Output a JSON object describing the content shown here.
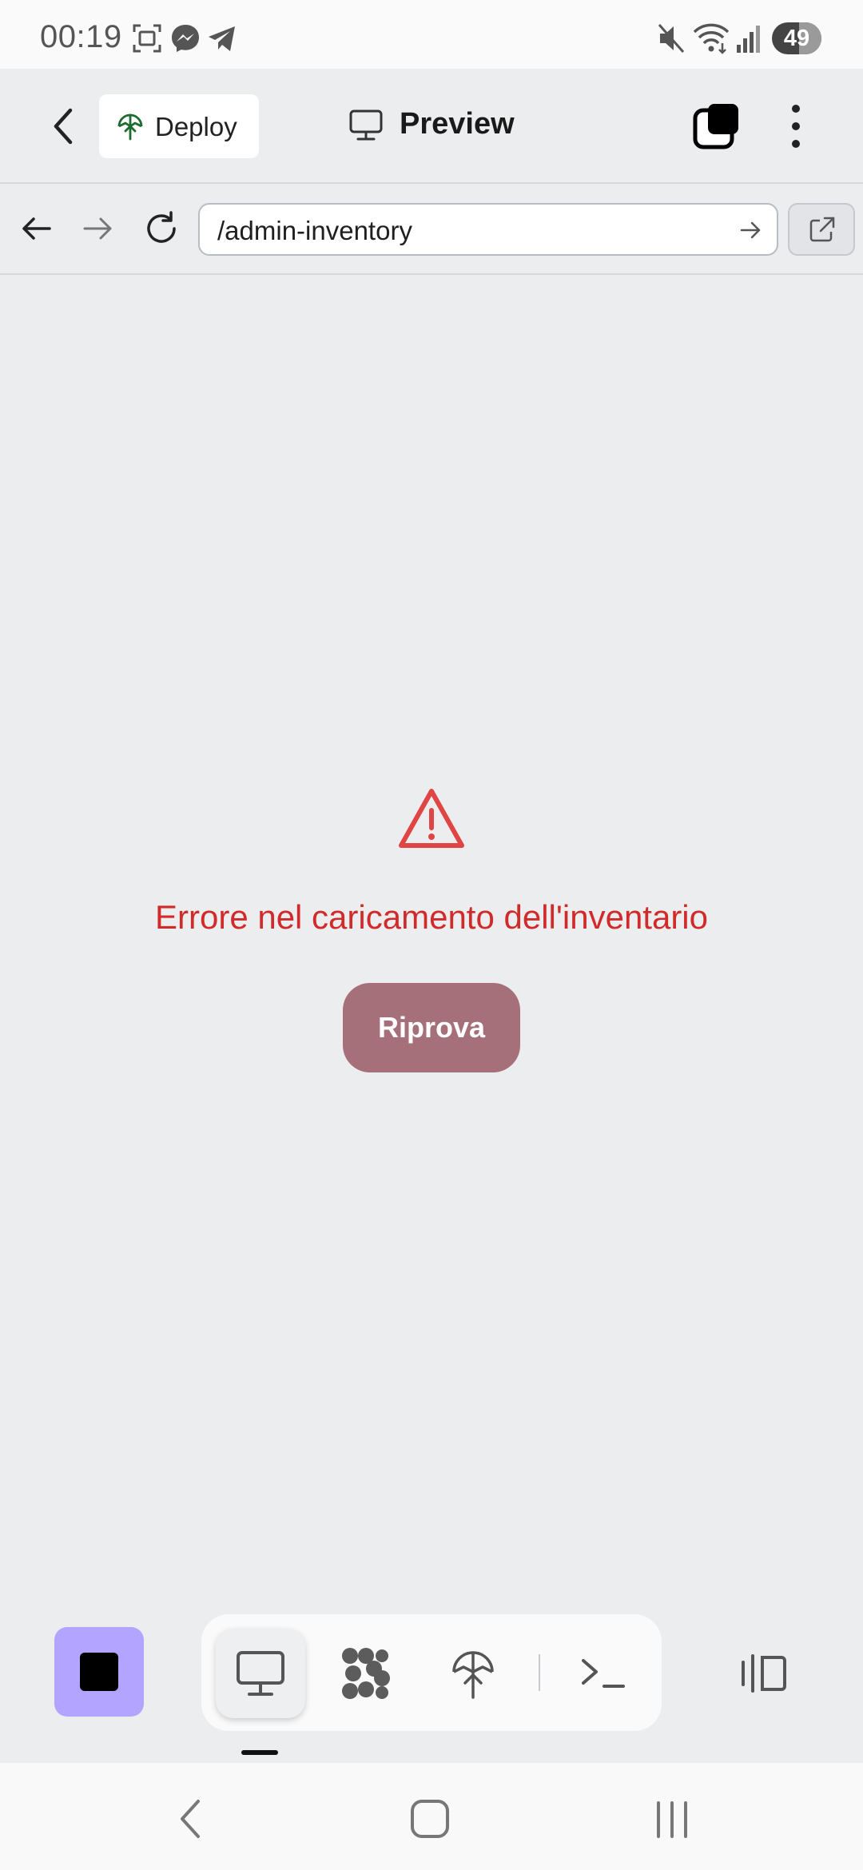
{
  "status_bar": {
    "time": "00:19",
    "battery": "49",
    "left_icons": [
      "screenshot-icon",
      "messenger-icon",
      "telegram-icon"
    ],
    "right_icons": [
      "mute-icon",
      "wifi-icon",
      "signal-icon"
    ]
  },
  "header": {
    "deploy_label": "Deploy",
    "title": "Preview"
  },
  "browser": {
    "url": "/admin-inventory"
  },
  "error": {
    "message": "Errore nel caricamento dell'inventario",
    "retry_label": "Riprova",
    "color": "#d12a2a",
    "button_color": "#a5707a"
  },
  "toolbar": {
    "stop_color": "#b3a4ff",
    "tools": [
      "monitor-icon",
      "extensions-icon",
      "deploy-icon",
      "terminal-icon"
    ],
    "active_tool": "monitor-icon"
  }
}
